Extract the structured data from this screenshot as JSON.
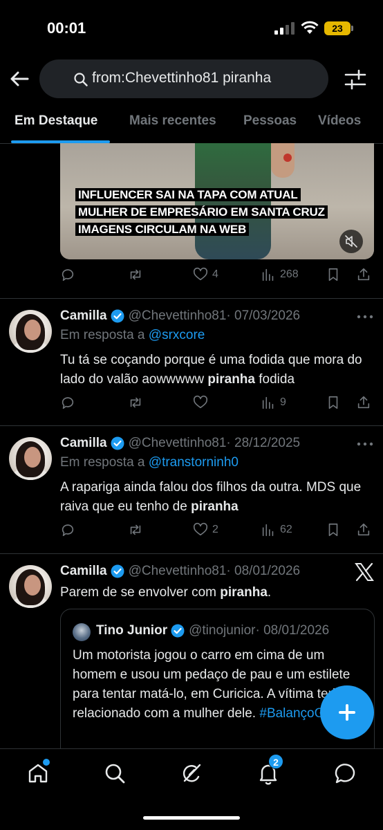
{
  "status_bar": {
    "time": "00:01",
    "battery": "23"
  },
  "search": {
    "query": "from:Chevettinho81 piranha"
  },
  "tabs": [
    {
      "label": "Em Destaque",
      "active": true
    },
    {
      "label": "Mais recentes",
      "active": false
    },
    {
      "label": "Pessoas",
      "active": false
    },
    {
      "label": "Vídeos",
      "active": false
    }
  ],
  "media_post": {
    "headline_lines": [
      "INFLUENCER SAI NA TAPA COM ATUAL",
      "MULHER DE EMPRESÁRIO EM SANTA CRUZ",
      "IMAGENS CIRCULAM NA WEB"
    ],
    "likes": "4",
    "views": "268"
  },
  "tweets": [
    {
      "name": "Camilla",
      "handle": "@Chevettinho81",
      "date": "· 07/03/2026",
      "reply_prefix": "Em resposta a ",
      "reply_to": "@srxcore",
      "text_before": "Tu tá se coçando porque é uma fodida que mora do lado do valão aowwwww ",
      "text_bold": "piranha",
      "text_after": " fodida",
      "likes": "",
      "views": "9"
    },
    {
      "name": "Camilla",
      "handle": "@Chevettinho81",
      "date": "· 28/12/2025",
      "reply_prefix": "Em resposta a ",
      "reply_to": "@transtorninh0",
      "text_before": "A rapariga ainda falou dos filhos da outra. MDS que raiva que eu tenho de ",
      "text_bold": "piranha",
      "text_after": "",
      "likes": "2",
      "views": "62"
    },
    {
      "name": "Camilla",
      "handle": "@Chevettinho81",
      "date": "· 08/01/2026",
      "text_before": "Parem de se envolver com ",
      "text_bold": "piranha",
      "text_after": "."
    }
  ],
  "quote": {
    "name": "Tino Junior",
    "handle": "@tinojunior",
    "date": "· 08/01/2026",
    "text": "Um motorista jogou o carro em cima de um homem e usou um pedaço de pau e um estilete para tentar matá-lo, em Curicica. A vítima teria se relacionado com a mulher dele. ",
    "hashtag": "#BalançoGeralRJ"
  },
  "bottom_nav": {
    "notifications_badge": "2"
  },
  "colors": {
    "accent": "#1d9bf0",
    "background": "#000000",
    "secondary_text": "#71767b"
  }
}
